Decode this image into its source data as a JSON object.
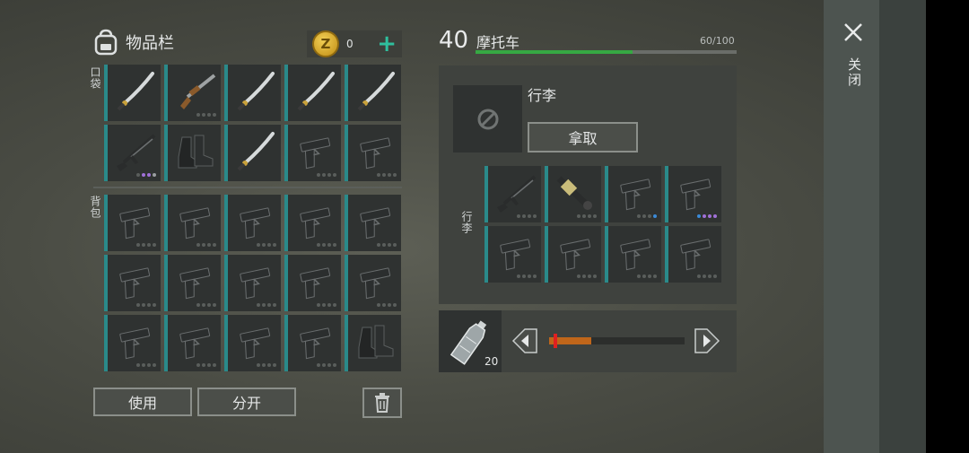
{
  "inventory": {
    "title": "物品栏",
    "coins": "0",
    "pocket_label": "口袋",
    "backpack_label": "背包",
    "pocket_slots": [
      "katana",
      "shotgun",
      "katana",
      "katana",
      "katana",
      "rifle",
      "boots",
      "katana",
      "pistol",
      "pistol"
    ],
    "backpack_slots": [
      "pistol",
      "pistol",
      "pistol",
      "pistol",
      "pistol",
      "pistol",
      "pistol",
      "pistol",
      "pistol",
      "pistol",
      "pistol",
      "pistol",
      "pistol",
      "pistol",
      "boots"
    ],
    "use_label": "使用",
    "split_label": "分开"
  },
  "vehicle": {
    "level": "40",
    "name": "摩托车",
    "capacity": "60/100",
    "capacity_fraction": 0.6,
    "luggage_title": "行李",
    "take_label": "拿取",
    "luggage_label": "行李",
    "luggage_slots": [
      "rifle",
      "launcher",
      "pistol",
      "pistol",
      "pistol",
      "pistol",
      "pistol",
      "pistol"
    ]
  },
  "consumable": {
    "count": "20",
    "slider_fraction": 0.31
  },
  "close_label": "关闭",
  "colors": {
    "accent": "#2a8a8a",
    "capacity_bar": "#36a843",
    "slider": "#c0661a",
    "coin": "#e0b02c"
  }
}
